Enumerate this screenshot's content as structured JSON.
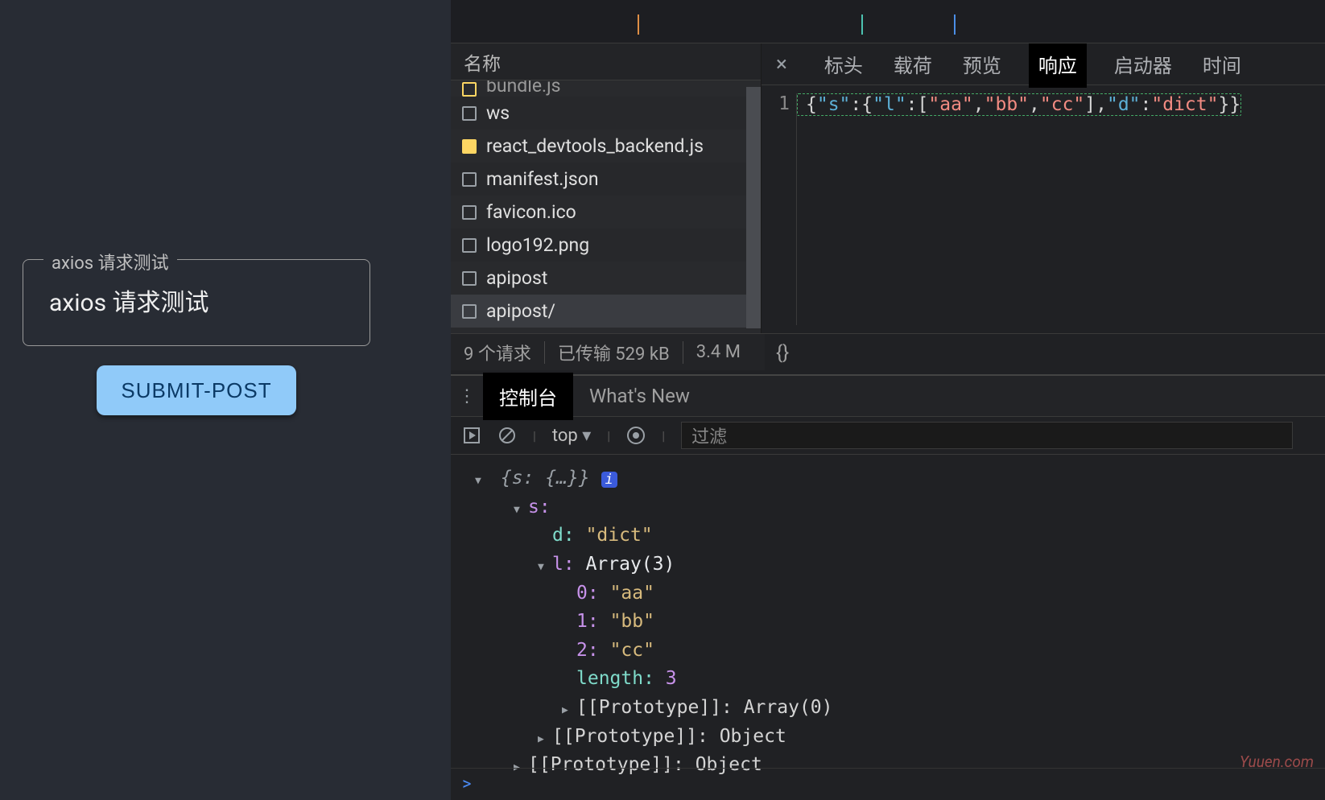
{
  "app": {
    "legend": "axios 请求测试",
    "body_text": "axios 请求测试",
    "submit_label": "SUBMIT-POST"
  },
  "network": {
    "list_header": "名称",
    "requests": [
      {
        "name": "bundle.js",
        "icon": "js",
        "cutoff": true
      },
      {
        "name": "ws",
        "icon": "doc"
      },
      {
        "name": "react_devtools_backend.js",
        "icon": "js-filled"
      },
      {
        "name": "manifest.json",
        "icon": "doc"
      },
      {
        "name": "favicon.ico",
        "icon": "doc"
      },
      {
        "name": "logo192.png",
        "icon": "doc"
      },
      {
        "name": "apipost",
        "icon": "doc"
      },
      {
        "name": "apipost/",
        "icon": "doc",
        "selected": true
      }
    ],
    "status_count": "9 个请求",
    "status_transfer": "已传输 529 kB",
    "status_time": "3.4 M"
  },
  "detail": {
    "tabs": [
      "标头",
      "载荷",
      "预览",
      "响应",
      "启动器",
      "时间"
    ],
    "active_tab": 3,
    "line_no": "1",
    "response_json": {
      "pre": "{",
      "k1": "\"s\"",
      "c1": ":",
      "b1": "{",
      "k2": "\"l\"",
      "c2": ":",
      "b2": "[",
      "v1": "\"aa\"",
      "cm1": ",",
      "v2": "\"bb\"",
      "cm2": ",",
      "v3": "\"cc\"",
      "b3": "],",
      "k3": "\"d\"",
      "c3": ":",
      "v4": "\"dict\"",
      "suf": "}}"
    },
    "footer_icon": "{}"
  },
  "drawer": {
    "tabs": {
      "console": "控制台",
      "whatsnew": "What's New"
    },
    "toolbar": {
      "scope": "top",
      "filter_placeholder": "过滤"
    }
  },
  "console": {
    "root": {
      "open": "{",
      "key": "s:",
      "preview": "{…}",
      "close": "}",
      "info": "i"
    },
    "s_key": "s:",
    "d": {
      "k": "d:",
      "v": "\"dict\""
    },
    "l": {
      "k": "l:",
      "type": "Array(3)"
    },
    "items": [
      {
        "k": "0:",
        "v": "\"aa\""
      },
      {
        "k": "1:",
        "v": "\"bb\""
      },
      {
        "k": "2:",
        "v": "\"cc\""
      }
    ],
    "length": {
      "k": "length:",
      "v": "3"
    },
    "proto_arr": "[[Prototype]]: Array(0)",
    "proto_obj1": "[[Prototype]]: Object",
    "proto_obj2": "[[Prototype]]: Object",
    "prompt": ">"
  },
  "watermark": "Yuuen.com",
  "chart_data": {
    "type": "table",
    "note": "not-a-chart"
  }
}
